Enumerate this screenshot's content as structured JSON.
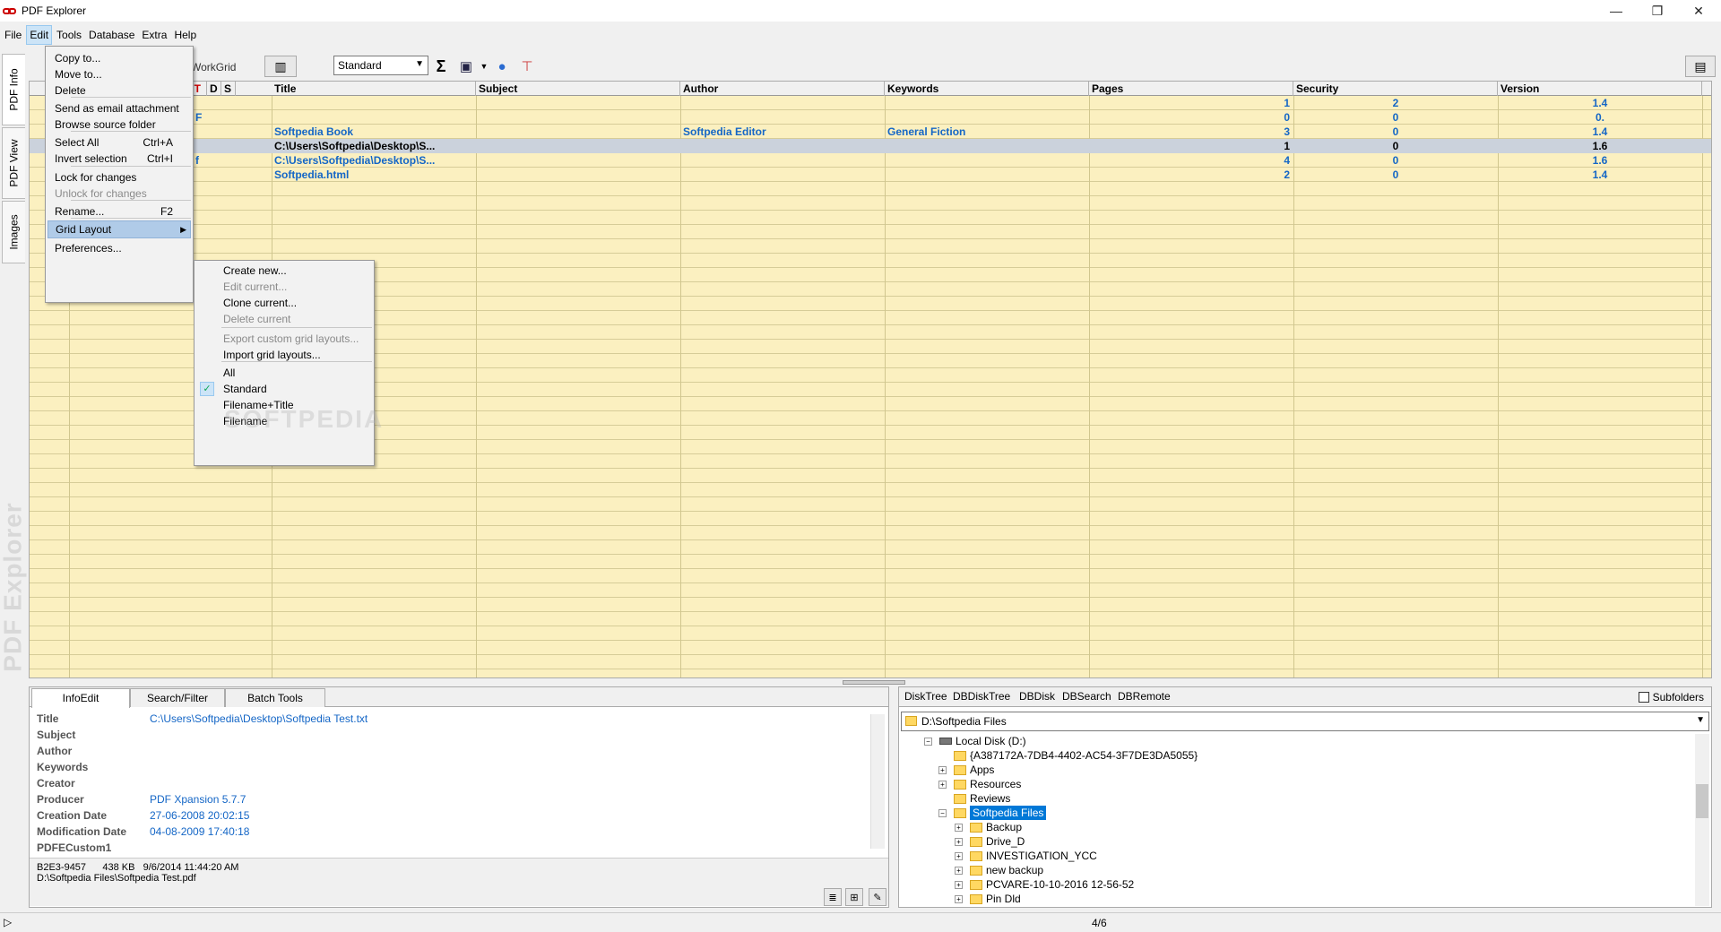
{
  "window": {
    "title": "PDF Explorer",
    "controls": {
      "minimize": "—",
      "restore": "❐",
      "close": "✕"
    }
  },
  "menubar": [
    "File",
    "Edit",
    "Tools",
    "Database",
    "Extra",
    "Help"
  ],
  "left_tabs": [
    "PDF Info",
    "PDF View",
    "Images"
  ],
  "brand_vertical": "PDF Explorer",
  "toolbar": {
    "workgrid_label": "WorkGrid",
    "layout_value": "Standard",
    "icons": [
      "grid-delete-icon",
      "sum-icon",
      "book-icon",
      "globe-icon",
      "pdf-export-icon",
      "column-layout-icon"
    ]
  },
  "grid": {
    "headers": [
      "T",
      "D",
      "S",
      "Title",
      "Subject",
      "Author",
      "Keywords",
      "Pages",
      "Security",
      "Version"
    ],
    "partial_cells": [
      "F",
      "f"
    ],
    "rows": [
      {
        "title": "",
        "subject": "",
        "author": "",
        "keywords": "",
        "pages": "1",
        "security": "2",
        "version": "1.4",
        "selected": false
      },
      {
        "title": "",
        "subject": "",
        "author": "",
        "keywords": "",
        "pages": "0",
        "security": "0",
        "version": "0.",
        "selected": false
      },
      {
        "title": "Softpedia Book",
        "subject": "",
        "author": "Softpedia Editor",
        "keywords": "General Fiction",
        "pages": "3",
        "security": "0",
        "version": "1.4",
        "selected": false
      },
      {
        "title": "C:\\Users\\Softpedia\\Desktop\\S...",
        "subject": "",
        "author": "",
        "keywords": "",
        "pages": "1",
        "security": "0",
        "version": "1.6",
        "selected": true
      },
      {
        "title": "C:\\Users\\Softpedia\\Desktop\\S...",
        "subject": "",
        "author": "",
        "keywords": "",
        "pages": "4",
        "security": "0",
        "version": "1.6",
        "selected": false
      },
      {
        "title": "Softpedia.html",
        "subject": "",
        "author": "",
        "keywords": "",
        "pages": "2",
        "security": "0",
        "version": "1.4",
        "selected": false
      }
    ]
  },
  "edit_menu": {
    "items": [
      {
        "label": "Copy to...",
        "shortcut": "",
        "disabled": false
      },
      {
        "label": "Move to...",
        "shortcut": "",
        "disabled": false
      },
      {
        "label": "Delete",
        "shortcut": "",
        "disabled": false
      },
      {
        "label": "Send as email attachment",
        "shortcut": "",
        "disabled": false
      },
      {
        "label": "Browse source folder",
        "shortcut": "",
        "disabled": false
      },
      {
        "label": "Select All",
        "shortcut": "Ctrl+A",
        "disabled": false
      },
      {
        "label": "Invert selection",
        "shortcut": "Ctrl+I",
        "disabled": false
      },
      {
        "label": "Lock for changes",
        "shortcut": "",
        "disabled": false
      },
      {
        "label": "Unlock for changes",
        "shortcut": "",
        "disabled": true
      },
      {
        "label": "Rename...",
        "shortcut": "F2",
        "disabled": false
      },
      {
        "label": "Grid Layout",
        "shortcut": "",
        "disabled": false
      },
      {
        "label": "Preferences...",
        "shortcut": "",
        "disabled": false
      }
    ]
  },
  "grid_layout_submenu": {
    "items": [
      {
        "label": "Create new...",
        "disabled": false,
        "checked": false
      },
      {
        "label": "Edit current...",
        "disabled": true,
        "checked": false
      },
      {
        "label": "Clone current...",
        "disabled": false,
        "checked": false
      },
      {
        "label": "Delete current",
        "disabled": true,
        "checked": false
      },
      {
        "label": "Export custom grid layouts...",
        "disabled": true,
        "checked": false
      },
      {
        "label": "Import grid layouts...",
        "disabled": false,
        "checked": false
      },
      {
        "label": "All",
        "disabled": false,
        "checked": false
      },
      {
        "label": "Standard",
        "disabled": false,
        "checked": true
      },
      {
        "label": "Filename+Title",
        "disabled": false,
        "checked": false
      },
      {
        "label": "Filename",
        "disabled": false,
        "checked": false
      }
    ]
  },
  "watermark": "SOFTPEDIA",
  "bottom_left": {
    "tabs": [
      "InfoEdit",
      "Search/Filter",
      "Batch Tools"
    ],
    "fields": [
      {
        "label": "Title",
        "value": "C:\\Users\\Softpedia\\Desktop\\Softpedia Test.txt"
      },
      {
        "label": "Subject",
        "value": ""
      },
      {
        "label": "Author",
        "value": ""
      },
      {
        "label": "Keywords",
        "value": ""
      },
      {
        "label": "Creator",
        "value": ""
      },
      {
        "label": "Producer",
        "value": "PDF Xpansion 5.7.7"
      },
      {
        "label": "Creation Date",
        "value": "27-06-2008 20:02:15"
      },
      {
        "label": "Modification Date",
        "value": "04-08-2009 17:40:18"
      },
      {
        "label": "PDFECustom1",
        "value": ""
      }
    ],
    "status_line1": "B2E3-9457      438 KB   9/6/2014 11:44:20 AM",
    "status_line2": "D:\\Softpedia Files\\Softpedia Test.pdf"
  },
  "bottom_right": {
    "tabs": [
      "DiskTree",
      "DBDiskTree",
      "DBDisk",
      "DBSearch",
      "DBRemote"
    ],
    "subfolders_label": "Subfolders",
    "path": "D:\\Softpedia Files",
    "tree": [
      {
        "label": "Local Disk (D:)",
        "level": 0,
        "expander": "−",
        "type": "drive",
        "selected": false
      },
      {
        "label": "{A387172A-7DB4-4402-AC54-3F7DE3DA5055}",
        "level": 1,
        "expander": "",
        "type": "folder",
        "selected": false
      },
      {
        "label": "Apps",
        "level": 1,
        "expander": "+",
        "type": "folder",
        "selected": false
      },
      {
        "label": "Resources",
        "level": 1,
        "expander": "+",
        "type": "folder",
        "selected": false
      },
      {
        "label": "Reviews",
        "level": 1,
        "expander": "",
        "type": "folder",
        "selected": false
      },
      {
        "label": "Softpedia Files",
        "level": 1,
        "expander": "−",
        "type": "folder",
        "selected": true
      },
      {
        "label": "Backup",
        "level": 2,
        "expander": "+",
        "type": "folder",
        "selected": false
      },
      {
        "label": "Drive_D",
        "level": 2,
        "expander": "+",
        "type": "folder",
        "selected": false
      },
      {
        "label": "INVESTIGATION_YCC",
        "level": 2,
        "expander": "+",
        "type": "folder",
        "selected": false
      },
      {
        "label": "new backup",
        "level": 2,
        "expander": "+",
        "type": "folder",
        "selected": false
      },
      {
        "label": "PCVARE-10-10-2016 12-56-52",
        "level": 2,
        "expander": "+",
        "type": "folder",
        "selected": false
      },
      {
        "label": "Pin Dld",
        "level": 2,
        "expander": "+",
        "type": "folder",
        "selected": false
      }
    ]
  },
  "statusbar": {
    "play": "▷",
    "count": "4/6"
  }
}
